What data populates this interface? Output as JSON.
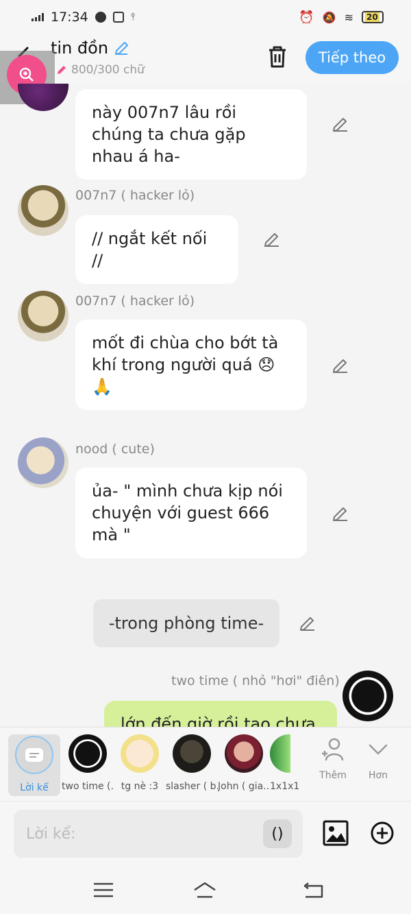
{
  "status": {
    "time": "17:34",
    "battery": "20"
  },
  "header": {
    "title": "tin đồn",
    "counter": "800/300 chữ",
    "next_label": "Tiếp theo"
  },
  "messages": [
    {
      "type": "left",
      "name": "",
      "text": "này 007n7 lâu rồi chúng ta chưa gặp nhau á ha-"
    },
    {
      "type": "left",
      "name": "007n7 ( hacker lỏ)",
      "text": "// ngắt kết nối //"
    },
    {
      "type": "left",
      "name": "007n7 ( hacker lỏ)",
      "text": "mốt đi chùa cho bớt tà khí trong người quá 😞 🙏"
    },
    {
      "type": "left",
      "name": "nood ( cute)",
      "text": "ủa- \" mình chưa kịp nói chuyện với guest 666 mà \""
    },
    {
      "type": "narration",
      "text": "-trong phòng time-"
    },
    {
      "type": "right",
      "name": "two time ( nhỏ \"hơi\" điên)",
      "text": "lớn đến giờ rồi tao chưa"
    }
  ],
  "characters": [
    {
      "name": "Lời kể",
      "selected": true
    },
    {
      "name": "two time (..."
    },
    {
      "name": "tg nè :3"
    },
    {
      "name": "slasher ( b..."
    },
    {
      "name": "John ( gia..."
    },
    {
      "name": "1x1x1"
    }
  ],
  "actions": {
    "more_label": "Thêm",
    "collapse_label": "Hơn"
  },
  "input": {
    "placeholder": "Lời kể:",
    "paren_label": "()"
  },
  "colors": {
    "accent": "#4da6f5",
    "zoom": "#f04f8c",
    "right_bubble": "#d6f09a"
  }
}
